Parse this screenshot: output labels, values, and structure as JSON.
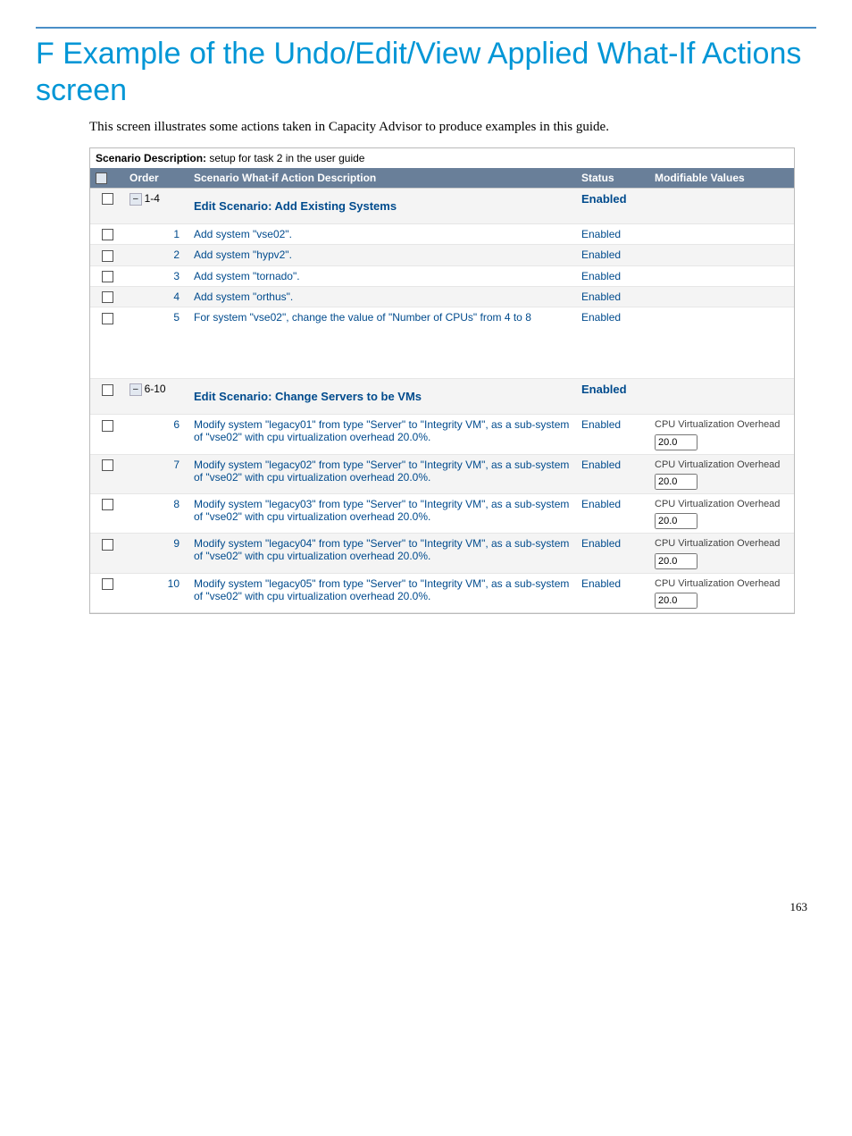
{
  "page_number": "163",
  "heading": "F Example of the Undo/Edit/View Applied What-If Actions screen",
  "intro": "This screen illustrates some actions taken in Capacity Advisor to produce examples in this guide.",
  "scenario_label": "Scenario Description:",
  "scenario_text": " setup for task 2 in the user guide",
  "headers": {
    "order": "Order",
    "desc": "Scenario What-if Action Description",
    "status": "Status",
    "mod": "Modifiable Values"
  },
  "group1": {
    "range": "1-4",
    "title": "Edit Scenario: Add Existing Systems",
    "status": "Enabled"
  },
  "rows1": [
    {
      "order": "1",
      "desc": "Add system \"vse02\".",
      "status": "Enabled"
    },
    {
      "order": "2",
      "desc": "Add system \"hypv2\".",
      "status": "Enabled"
    },
    {
      "order": "3",
      "desc": "Add system \"tornado\".",
      "status": "Enabled"
    },
    {
      "order": "4",
      "desc": "Add system \"orthus\".",
      "status": "Enabled"
    },
    {
      "order": "5",
      "desc": "For system \"vse02\", change the value of \"Number of CPUs\" from 4 to 8",
      "status": "Enabled"
    }
  ],
  "group2": {
    "range": "6-10",
    "title": "Edit Scenario: Change Servers to be VMs",
    "status": "Enabled"
  },
  "mod_label": "CPU Virtualization Overhead",
  "mod_value": "20.0",
  "rows2": [
    {
      "order": "6",
      "desc": "Modify system \"legacy01\" from type \"Server\" to \"Integrity VM\", as a sub-system of \"vse02\" with cpu virtualization overhead 20.0%.",
      "status": "Enabled"
    },
    {
      "order": "7",
      "desc": "Modify system \"legacy02\" from type \"Server\" to \"Integrity VM\", as a sub-system of \"vse02\" with cpu virtualization overhead 20.0%.",
      "status": "Enabled"
    },
    {
      "order": "8",
      "desc": "Modify system \"legacy03\" from type \"Server\" to \"Integrity VM\", as a sub-system of \"vse02\" with cpu virtualization overhead 20.0%.",
      "status": "Enabled"
    },
    {
      "order": "9",
      "desc": "Modify system \"legacy04\" from type \"Server\" to \"Integrity VM\", as a sub-system of \"vse02\" with cpu virtualization overhead 20.0%.",
      "status": "Enabled"
    },
    {
      "order": "10",
      "desc": "Modify system \"legacy05\" from type \"Server\" to \"Integrity VM\", as a sub-system of \"vse02\" with cpu virtualization overhead 20.0%.",
      "status": "Enabled"
    }
  ]
}
